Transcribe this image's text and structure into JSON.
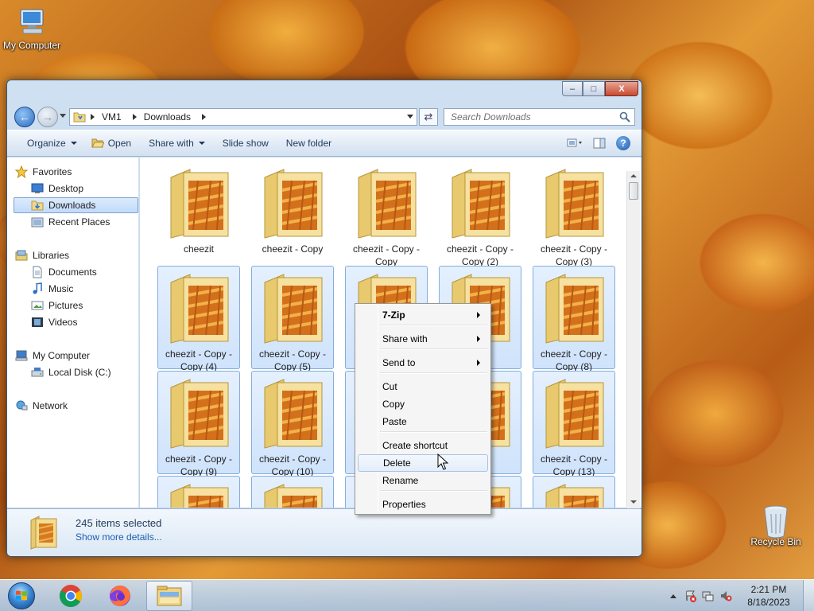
{
  "desktop": {
    "my_computer_label": "My Computer",
    "recycle_bin_label": "Recycle Bin"
  },
  "window": {
    "buttons": {
      "minimize": "–",
      "maximize": "□",
      "close": "X"
    },
    "address": {
      "crumbs": [
        "VM1",
        "Downloads"
      ],
      "search_placeholder": "Search Downloads"
    },
    "toolbar": {
      "organize": "Organize",
      "open": "Open",
      "share_with": "Share with",
      "slide_show": "Slide show",
      "new_folder": "New folder",
      "help": "?"
    },
    "nav": {
      "favorites": "Favorites",
      "desktop": "Desktop",
      "downloads": "Downloads",
      "recent_places": "Recent Places",
      "libraries": "Libraries",
      "documents": "Documents",
      "music": "Music",
      "pictures": "Pictures",
      "videos": "Videos",
      "my_computer": "My Computer",
      "local_disk": "Local Disk (C:)",
      "network": "Network"
    },
    "folders": [
      {
        "label": "cheezit",
        "selected": false
      },
      {
        "label": "cheezit - Copy",
        "selected": false
      },
      {
        "label": "cheezit - Copy - Copy",
        "selected": false
      },
      {
        "label": "cheezit - Copy - Copy (2)",
        "selected": false
      },
      {
        "label": "cheezit - Copy - Copy (3)",
        "selected": false
      },
      {
        "label": "cheezit - Copy - Copy (4)",
        "selected": true
      },
      {
        "label": "cheezit - Copy - Copy (5)",
        "selected": true
      },
      {
        "label": "ch",
        "selected": true
      },
      {
        "label": "y -",
        "selected": true
      },
      {
        "label": "cheezit - Copy - Copy (8)",
        "selected": true
      },
      {
        "label": "cheezit - Copy - Copy (9)",
        "selected": true
      },
      {
        "label": "cheezit - Copy - Copy (10)",
        "selected": true
      },
      {
        "label": "ch",
        "selected": true
      },
      {
        "label": "y -",
        "selected": true
      },
      {
        "label": "cheezit - Copy - Copy (13)",
        "selected": true
      },
      {
        "label": "",
        "selected": true
      },
      {
        "label": "",
        "selected": true
      },
      {
        "label": "",
        "selected": true
      },
      {
        "label": "",
        "selected": true
      },
      {
        "label": "",
        "selected": true
      }
    ],
    "details": {
      "count": "245 items selected",
      "more": "Show more details..."
    }
  },
  "context_menu": {
    "items": [
      {
        "label": "7-Zip",
        "bold": true,
        "submenu": true
      },
      {
        "label": "Share with",
        "submenu": true
      },
      {
        "label": "Send to",
        "submenu": true
      },
      {
        "label": "Cut"
      },
      {
        "label": "Copy"
      },
      {
        "label": "Paste"
      },
      {
        "label": "Create shortcut"
      },
      {
        "label": "Delete",
        "hover": true
      },
      {
        "label": "Rename"
      },
      {
        "label": "Properties"
      }
    ]
  },
  "taskbar": {
    "time": "2:21 PM",
    "date": "8/18/2023",
    "apps": [
      "chrome",
      "firefox",
      "windows-explorer"
    ]
  },
  "colors": {
    "selection_fill": "#cfe3fc",
    "selection_border": "#84acdd",
    "link": "#1a5fb4"
  }
}
